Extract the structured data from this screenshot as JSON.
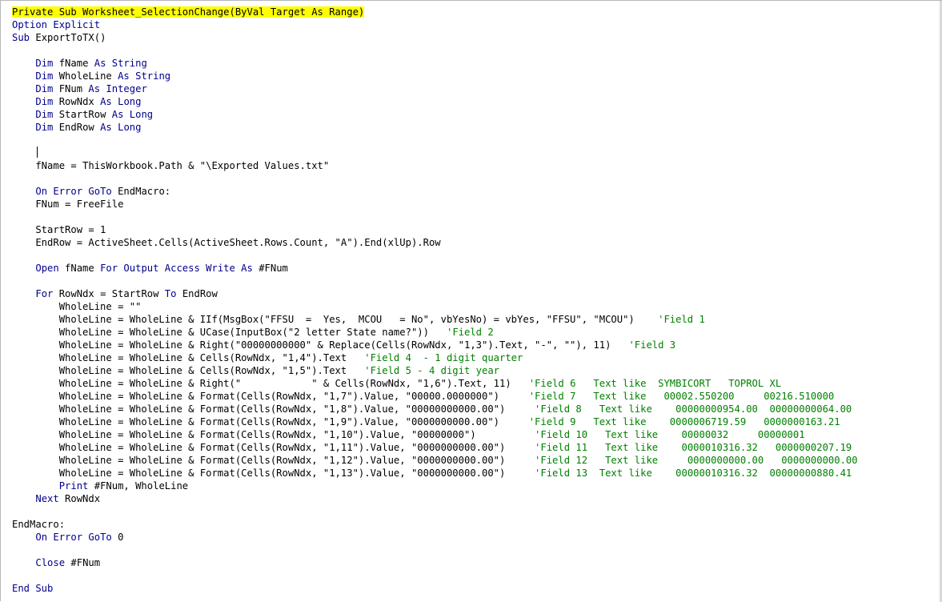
{
  "editor": {
    "highlight_color": "#ffff00",
    "keyword_color": "#00008b",
    "comment_color": "#008000",
    "lines": [
      [
        {
          "t": "Private Sub Worksheet_SelectionChange(ByVal Target As Range)",
          "c": "hl"
        }
      ],
      [
        {
          "t": "Option Explicit",
          "c": "kw"
        }
      ],
      [
        {
          "t": "Sub ",
          "c": "kw"
        },
        {
          "t": "ExportToTX()"
        }
      ],
      [],
      [
        {
          "t": "    "
        },
        {
          "t": "Dim ",
          "c": "kw"
        },
        {
          "t": "fName "
        },
        {
          "t": "As String",
          "c": "kw"
        }
      ],
      [
        {
          "t": "    "
        },
        {
          "t": "Dim ",
          "c": "kw"
        },
        {
          "t": "WholeLine "
        },
        {
          "t": "As String",
          "c": "kw"
        }
      ],
      [
        {
          "t": "    "
        },
        {
          "t": "Dim ",
          "c": "kw"
        },
        {
          "t": "FNum "
        },
        {
          "t": "As Integer",
          "c": "kw"
        }
      ],
      [
        {
          "t": "    "
        },
        {
          "t": "Dim ",
          "c": "kw"
        },
        {
          "t": "RowNdx "
        },
        {
          "t": "As Long",
          "c": "kw"
        }
      ],
      [
        {
          "t": "    "
        },
        {
          "t": "Dim ",
          "c": "kw"
        },
        {
          "t": "StartRow "
        },
        {
          "t": "As Long",
          "c": "kw"
        }
      ],
      [
        {
          "t": "    "
        },
        {
          "t": "Dim ",
          "c": "kw"
        },
        {
          "t": "EndRow "
        },
        {
          "t": "As Long",
          "c": "kw"
        }
      ],
      [],
      [
        {
          "t": "    "
        }
      ],
      [
        {
          "t": "    fName = ThisWorkbook.Path & \"\\Exported Values.txt\""
        }
      ],
      [],
      [
        {
          "t": "    "
        },
        {
          "t": "On Error GoTo ",
          "c": "kw"
        },
        {
          "t": "EndMacro:"
        }
      ],
      [
        {
          "t": "    FNum = FreeFile"
        }
      ],
      [],
      [
        {
          "t": "    StartRow = 1"
        }
      ],
      [
        {
          "t": "    EndRow = ActiveSheet.Cells(ActiveSheet.Rows.Count, \"A\").End(xlUp).Row"
        }
      ],
      [],
      [
        {
          "t": "    "
        },
        {
          "t": "Open ",
          "c": "kw"
        },
        {
          "t": "fName "
        },
        {
          "t": "For Output Access Write As ",
          "c": "kw"
        },
        {
          "t": "#FNum"
        }
      ],
      [],
      [
        {
          "t": "    "
        },
        {
          "t": "For ",
          "c": "kw"
        },
        {
          "t": "RowNdx = StartRow "
        },
        {
          "t": "To ",
          "c": "kw"
        },
        {
          "t": "EndRow"
        }
      ],
      [
        {
          "t": "        WholeLine = \"\""
        }
      ],
      [
        {
          "t": "        WholeLine = WholeLine & IIf(MsgBox(\"FFSU  =  Yes,  MCOU   = No\", vbYesNo) = vbYes, \"FFSU\", \"MCOU\")    "
        },
        {
          "t": "'Field 1",
          "c": "cm"
        }
      ],
      [
        {
          "t": "        WholeLine = WholeLine & UCase(InputBox(\"2 letter State name?\"))   "
        },
        {
          "t": "'Field 2",
          "c": "cm"
        }
      ],
      [
        {
          "t": "        WholeLine = WholeLine & Right(\"00000000000\" & Replace(Cells(RowNdx, \"1,3\").Text, \"-\", \"\"), 11)   "
        },
        {
          "t": "'Field 3",
          "c": "cm"
        }
      ],
      [
        {
          "t": "        WholeLine = WholeLine & Cells(RowNdx, \"1,4\").Text   "
        },
        {
          "t": "'Field 4  - 1 digit quarter",
          "c": "cm"
        }
      ],
      [
        {
          "t": "        WholeLine = WholeLine & Cells(RowNdx, \"1,5\").Text   "
        },
        {
          "t": "'Field 5 - 4 digit year",
          "c": "cm"
        }
      ],
      [
        {
          "t": "        WholeLine = WholeLine & Right(\"            \" & Cells(RowNdx, \"1,6\").Text, 11)   "
        },
        {
          "t": "'Field 6   Text like  SYMBICORT   TOPROL XL",
          "c": "cm"
        }
      ],
      [
        {
          "t": "        WholeLine = WholeLine & Format(Cells(RowNdx, \"1,7\").Value, \"00000.0000000\")     "
        },
        {
          "t": "'Field 7   Text like   00002.550200     00216.510000",
          "c": "cm"
        }
      ],
      [
        {
          "t": "        WholeLine = WholeLine & Format(Cells(RowNdx, \"1,8\").Value, \"00000000000.00\")     "
        },
        {
          "t": "'Field 8   Text like    00000000954.00  00000000064.00",
          "c": "cm"
        }
      ],
      [
        {
          "t": "        WholeLine = WholeLine & Format(Cells(RowNdx, \"1,9\").Value, \"0000000000.00\")     "
        },
        {
          "t": "'Field 9   Text like    0000006719.59   0000000163.21",
          "c": "cm"
        }
      ],
      [
        {
          "t": "        WholeLine = WholeLine & Format(Cells(RowNdx, \"1,10\").Value, \"00000000\")          "
        },
        {
          "t": "'Field 10   Text like    00000032     00000001",
          "c": "cm"
        }
      ],
      [
        {
          "t": "        WholeLine = WholeLine & Format(Cells(RowNdx, \"1,11\").Value, \"0000000000.00\")     "
        },
        {
          "t": "'Field 11   Text like    0000010316.32   0000000207.19",
          "c": "cm"
        }
      ],
      [
        {
          "t": "        WholeLine = WholeLine & Format(Cells(RowNdx, \"1,12\").Value, \"0000000000.00\")     "
        },
        {
          "t": "'Field 12   Text like     0000000000.00   0000000000.00",
          "c": "cm"
        }
      ],
      [
        {
          "t": "        WholeLine = WholeLine & Format(Cells(RowNdx, \"1,13\").Value, \"0000000000.00\")     "
        },
        {
          "t": "'Field 13  Text like    00000010316.32  00000000880.41",
          "c": "cm"
        }
      ],
      [
        {
          "t": "        "
        },
        {
          "t": "Print ",
          "c": "kw"
        },
        {
          "t": "#FNum, WholeLine"
        }
      ],
      [
        {
          "t": "    "
        },
        {
          "t": "Next ",
          "c": "kw"
        },
        {
          "t": "RowNdx"
        }
      ],
      [],
      [
        {
          "t": "EndMacro:"
        }
      ],
      [
        {
          "t": "    "
        },
        {
          "t": "On Error GoTo ",
          "c": "kw"
        },
        {
          "t": "0"
        }
      ],
      [],
      [
        {
          "t": "    "
        },
        {
          "t": "Close ",
          "c": "kw"
        },
        {
          "t": "#FNum"
        }
      ],
      [],
      [
        {
          "t": "End Sub",
          "c": "kw"
        }
      ]
    ]
  }
}
